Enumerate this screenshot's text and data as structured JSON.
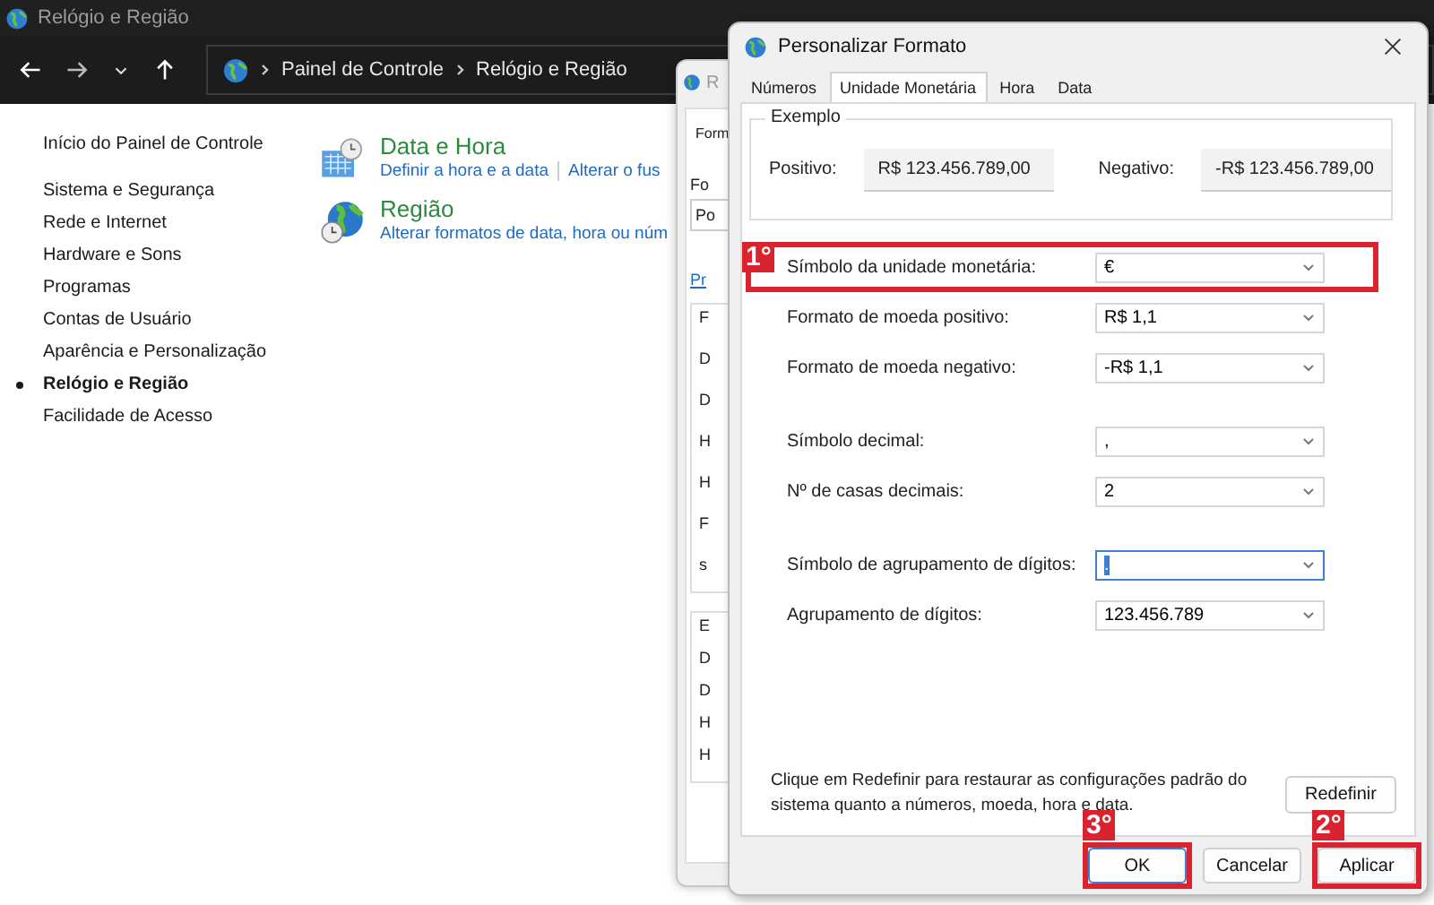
{
  "window": {
    "title": "Relógio e Região"
  },
  "nav": {
    "breadcrumbs": [
      "Painel de Controle",
      "Relógio e Região"
    ]
  },
  "sidebar": {
    "home": "Início do Painel de Controle",
    "items": [
      {
        "label": "Sistema e Segurança",
        "selected": false
      },
      {
        "label": "Rede e Internet",
        "selected": false
      },
      {
        "label": "Hardware e Sons",
        "selected": false
      },
      {
        "label": "Programas",
        "selected": false
      },
      {
        "label": "Contas de Usuário",
        "selected": false
      },
      {
        "label": "Aparência e Personalização",
        "selected": false
      },
      {
        "label": "Relógio e Região",
        "selected": true
      },
      {
        "label": "Facilidade de Acesso",
        "selected": false
      }
    ]
  },
  "categories": [
    {
      "kind": "calendar",
      "title": "Data e Hora",
      "links": [
        "Definir a hora e a data",
        "Alterar o fus"
      ]
    },
    {
      "kind": "globe",
      "title": "Região",
      "links": [
        "Alterar formatos de data, hora ou núm"
      ]
    }
  ],
  "behind_dialog": {
    "title": "R",
    "tab": "Form",
    "label": "Fo",
    "combo": "Po",
    "link": "Pr",
    "groups": [
      {
        "items": [
          "F",
          "D",
          "D",
          "H",
          "H",
          "F",
          "s"
        ]
      },
      {
        "items": [
          "E",
          "D",
          "D",
          "H",
          "H"
        ]
      }
    ]
  },
  "dialog": {
    "title": "Personalizar Formato",
    "tabs": [
      {
        "label": "Números",
        "selected": false
      },
      {
        "label": "Unidade Monetária",
        "selected": true
      },
      {
        "label": "Hora",
        "selected": false
      },
      {
        "label": "Data",
        "selected": false
      }
    ],
    "example": {
      "title": "Exemplo",
      "positive_label": "Positivo:",
      "positive": "R$ 123.456.789,00",
      "negative_label": "Negativo:",
      "negative": "-R$ 123.456.789,00"
    },
    "settings": [
      [
        {
          "label": "Símbolo da unidade monetária:",
          "value": "€",
          "focused": false,
          "annotation": "1°"
        },
        {
          "label": "Formato de moeda positivo:",
          "value": "R$ 1,1",
          "focused": false
        },
        {
          "label": "Formato de moeda negativo:",
          "value": "-R$ 1,1",
          "focused": false
        }
      ],
      [
        {
          "label": "Símbolo decimal:",
          "value": ",",
          "focused": false
        },
        {
          "label": "Nº de casas decimais:",
          "value": "2",
          "focused": false
        }
      ],
      [
        {
          "label": "Símbolo de agrupamento de dígitos:",
          "value": ".",
          "focused": true
        },
        {
          "label": "Agrupamento de dígitos:",
          "value": "123.456.789",
          "focused": false
        }
      ]
    ],
    "reset_note": "Clique em Redefinir para restaurar as configurações padrão do sistema quanto a números, moeda, hora e data.",
    "reset_button": "Redefinir",
    "buttons": [
      {
        "label": "OK",
        "default": true,
        "annotation": "3°"
      },
      {
        "label": "Cancelar",
        "default": false
      },
      {
        "label": "Aplicar",
        "default": false,
        "annotation": "2°"
      }
    ]
  }
}
